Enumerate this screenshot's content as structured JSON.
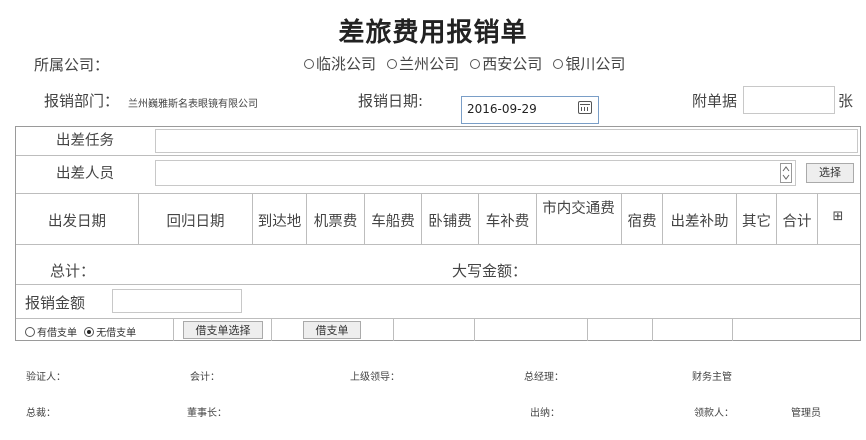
{
  "title": "差旅费用报销单",
  "company": {
    "label": "所属公司：",
    "options": [
      "临洮公司",
      "兰州公司",
      "西安公司",
      "银川公司"
    ]
  },
  "dept": {
    "label": "报销部门：",
    "value": "兰州巍雅斯名表眼镜有限公司"
  },
  "date": {
    "label": "报销日期:",
    "value": "2016-09-29"
  },
  "attach": {
    "label": "附单据",
    "unit": "张"
  },
  "task": {
    "label": "出差任务"
  },
  "person": {
    "label": "出差人员",
    "select_button": "选择"
  },
  "table": {
    "headers": [
      "出发日期",
      "回归日期",
      "到达地",
      "机票费",
      "车船费",
      "卧铺费",
      "车补费",
      "市内交通费",
      "宿费",
      "出差补助",
      "其它",
      "合计"
    ],
    "add_icon": "⊞"
  },
  "total": {
    "label": "总计：",
    "capital_label": "大写金额："
  },
  "reimburse": {
    "label": "报销金额"
  },
  "loan": {
    "options": [
      "有借支单",
      "无借支单"
    ],
    "selected": "无借支单",
    "choose_button": "借支单选择",
    "loan_button": "借支单"
  },
  "signatures": {
    "row1": [
      "验证人：",
      "会计：",
      "上级领导：",
      "总经理：",
      "财务主管"
    ],
    "row2": [
      "总裁：",
      "董事长：",
      "出纳：",
      "领款人：",
      "管理员"
    ]
  }
}
